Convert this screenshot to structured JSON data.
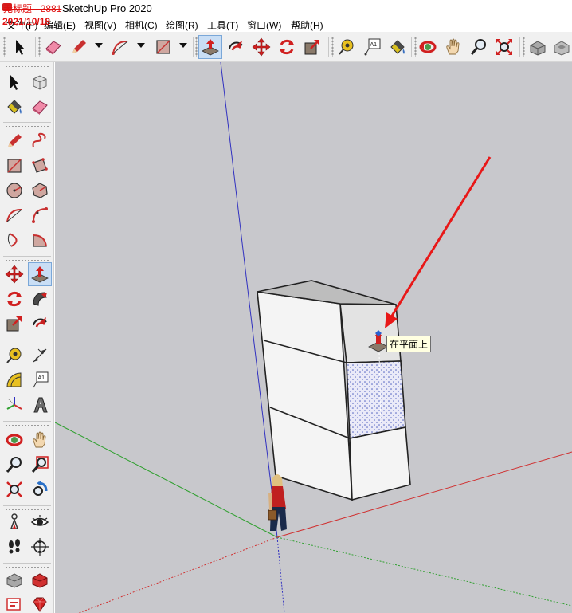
{
  "window": {
    "title": "SketchUp Pro 2020",
    "title_strike_prefix": "无标题 - 2881",
    "watermark_date": "2021/10/18"
  },
  "menubar": {
    "items": [
      "文件(F)",
      "编辑(E)",
      "视图(V)",
      "相机(C)",
      "绘图(R)",
      "工具(T)",
      "窗口(W)",
      "帮助(H)"
    ]
  },
  "toolbar": {
    "tools": [
      {
        "name": "select-tool",
        "icon": "arrow-cursor-icon"
      },
      {
        "name": "eraser-tool",
        "icon": "eraser-icon"
      },
      {
        "name": "line-tool",
        "icon": "pencil-icon"
      },
      {
        "name": "arc-tool",
        "icon": "arc-icon"
      },
      {
        "name": "rectangle-tool",
        "icon": "rectangle-icon"
      },
      {
        "name": "push-pull-tool",
        "icon": "push-pull-icon",
        "active": true
      },
      {
        "name": "offset-tool",
        "icon": "offset-icon"
      },
      {
        "name": "move-tool",
        "icon": "move-icon"
      },
      {
        "name": "rotate-tool",
        "icon": "rotate-icon"
      },
      {
        "name": "scale-tool",
        "icon": "scale-icon"
      },
      {
        "name": "tape-measure-tool",
        "icon": "tape-measure-icon"
      },
      {
        "name": "text-tool",
        "icon": "text-icon"
      },
      {
        "name": "paint-bucket-tool",
        "icon": "paint-bucket-icon"
      },
      {
        "name": "orbit-tool",
        "icon": "orbit-icon"
      },
      {
        "name": "pan-tool",
        "icon": "hand-icon"
      },
      {
        "name": "zoom-tool",
        "icon": "magnifier-icon"
      },
      {
        "name": "zoom-extents-tool",
        "icon": "zoom-extents-icon"
      },
      {
        "name": "warehouse-button",
        "icon": "warehouse-icon"
      },
      {
        "name": "extension-warehouse-button",
        "icon": "extension-warehouse-icon"
      }
    ]
  },
  "text_tool_label": "A1",
  "viewport": {
    "inference_tooltip": "在平面上",
    "annotation_color": "#e81818",
    "background_color": "#c8c8cc",
    "axis_colors": {
      "red": "#d03030",
      "green": "#30a030",
      "blue": "#3030c0"
    }
  }
}
